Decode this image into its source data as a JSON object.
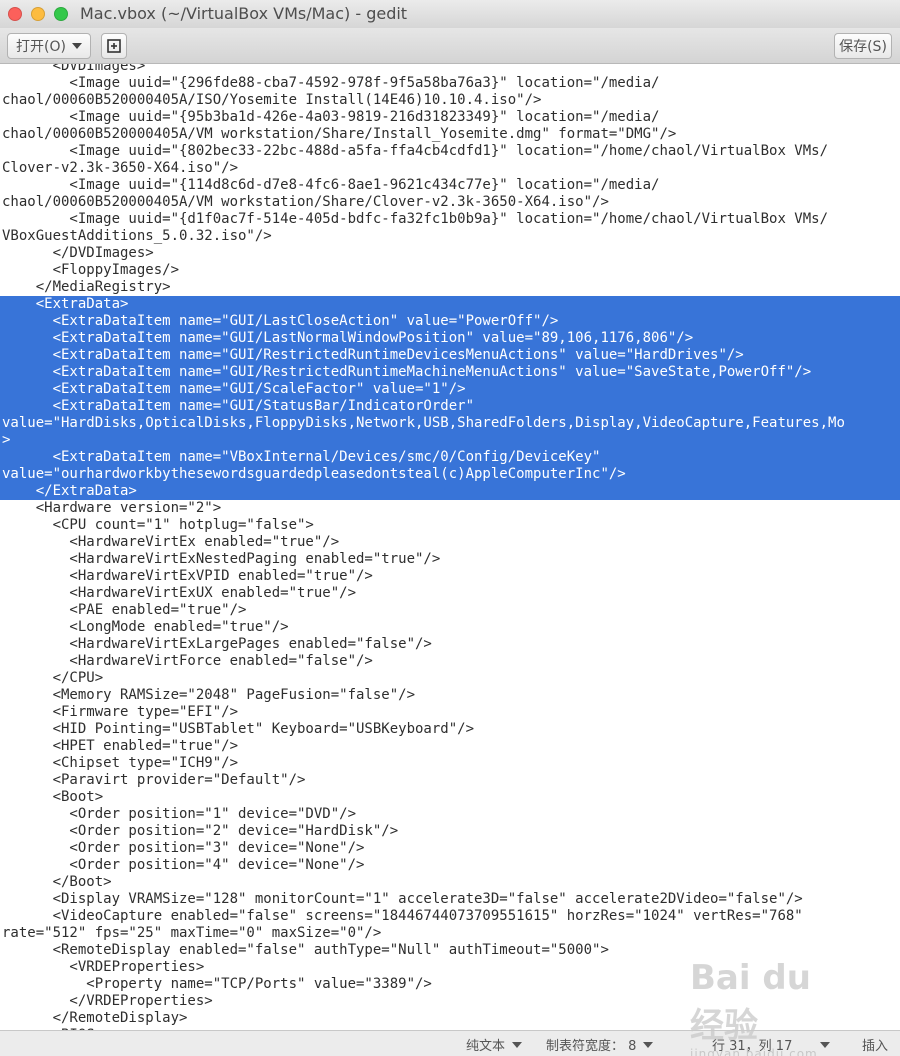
{
  "window": {
    "title": "Mac.vbox (~/VirtualBox VMs/Mac) - gedit"
  },
  "toolbar": {
    "open_label": "打开(O)",
    "save_label": "保存(S)"
  },
  "editor": {
    "lines": [
      "      <DVDImages>",
      "        <Image uuid=\"{296fde88-cba7-4592-978f-9f5a58ba76a3}\" location=\"/media/",
      "chaol/00060B520000405A/ISO/Yosemite Install(14E46)10.10.4.iso\"/>",
      "        <Image uuid=\"{95b3ba1d-426e-4a03-9819-216d31823349}\" location=\"/media/",
      "chaol/00060B520000405A/VM workstation/Share/Install_Yosemite.dmg\" format=\"DMG\"/>",
      "        <Image uuid=\"{802bec33-22bc-488d-a5fa-ffa4cb4cdfd1}\" location=\"/home/chaol/VirtualBox VMs/",
      "Clover-v2.3k-3650-X64.iso\"/>",
      "        <Image uuid=\"{114d8c6d-d7e8-4fc6-8ae1-9621c434c77e}\" location=\"/media/",
      "chaol/00060B520000405A/VM workstation/Share/Clover-v2.3k-3650-X64.iso\"/>",
      "        <Image uuid=\"{d1f0ac7f-514e-405d-bdfc-fa32fc1b0b9a}\" location=\"/home/chaol/VirtualBox VMs/",
      "VBoxGuestAdditions_5.0.32.iso\"/>",
      "      </DVDImages>",
      "      <FloppyImages/>",
      "    </MediaRegistry>",
      "    <ExtraData>",
      "      <ExtraDataItem name=\"GUI/LastCloseAction\" value=\"PowerOff\"/>",
      "      <ExtraDataItem name=\"GUI/LastNormalWindowPosition\" value=\"89,106,1176,806\"/>",
      "      <ExtraDataItem name=\"GUI/RestrictedRuntimeDevicesMenuActions\" value=\"HardDrives\"/>",
      "      <ExtraDataItem name=\"GUI/RestrictedRuntimeMachineMenuActions\" value=\"SaveState,PowerOff\"/>",
      "      <ExtraDataItem name=\"GUI/ScaleFactor\" value=\"1\"/>",
      "      <ExtraDataItem name=\"GUI/StatusBar/IndicatorOrder\"",
      "value=\"HardDisks,OpticalDisks,FloppyDisks,Network,USB,SharedFolders,Display,VideoCapture,Features,Mo",
      ">",
      "      <ExtraDataItem name=\"VBoxInternal/Devices/smc/0/Config/DeviceKey\"",
      "value=\"ourhardworkbythesewordsguardedpleasedontsteal(c)AppleComputerInc\"/>",
      "    </ExtraData>",
      "    <Hardware version=\"2\">",
      "      <CPU count=\"1\" hotplug=\"false\">",
      "        <HardwareVirtEx enabled=\"true\"/>",
      "        <HardwareVirtExNestedPaging enabled=\"true\"/>",
      "        <HardwareVirtExVPID enabled=\"true\"/>",
      "        <HardwareVirtExUX enabled=\"true\"/>",
      "        <PAE enabled=\"true\"/>",
      "        <LongMode enabled=\"true\"/>",
      "        <HardwareVirtExLargePages enabled=\"false\"/>",
      "        <HardwareVirtForce enabled=\"false\"/>",
      "      </CPU>",
      "      <Memory RAMSize=\"2048\" PageFusion=\"false\"/>",
      "      <Firmware type=\"EFI\"/>",
      "      <HID Pointing=\"USBTablet\" Keyboard=\"USBKeyboard\"/>",
      "      <HPET enabled=\"true\"/>",
      "      <Chipset type=\"ICH9\"/>",
      "      <Paravirt provider=\"Default\"/>",
      "      <Boot>",
      "        <Order position=\"1\" device=\"DVD\"/>",
      "        <Order position=\"2\" device=\"HardDisk\"/>",
      "        <Order position=\"3\" device=\"None\"/>",
      "        <Order position=\"4\" device=\"None\"/>",
      "      </Boot>",
      "      <Display VRAMSize=\"128\" monitorCount=\"1\" accelerate3D=\"false\" accelerate2DVideo=\"false\"/>",
      "      <VideoCapture enabled=\"false\" screens=\"18446744073709551615\" horzRes=\"1024\" vertRes=\"768\"",
      "rate=\"512\" fps=\"25\" maxTime=\"0\" maxSize=\"0\"/>",
      "      <RemoteDisplay enabled=\"false\" authType=\"Null\" authTimeout=\"5000\">",
      "        <VRDEProperties>",
      "          <Property name=\"TCP/Ports\" value=\"3389\"/>",
      "        </VRDEProperties>",
      "      </RemoteDisplay>",
      "      <BIOS>"
    ],
    "selection": {
      "first_line": 14,
      "last_line": 25
    },
    "selection_color": "#3874d8"
  },
  "statusbar": {
    "language": "纯文本",
    "tab_width": "制表符宽度：  8",
    "position": "行 31，列 17",
    "mode": "插入"
  },
  "watermark": {
    "brand": "Bai du 经验",
    "url": "jingyan.baidu.com"
  }
}
